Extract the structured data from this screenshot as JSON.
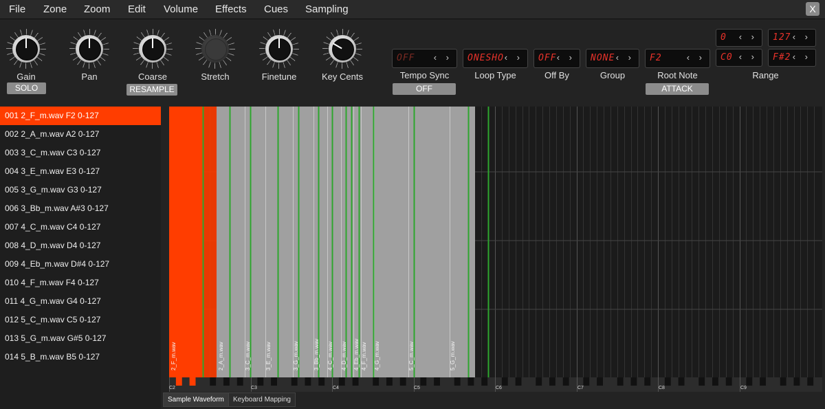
{
  "menu": [
    "File",
    "Zone",
    "Zoom",
    "Edit",
    "Volume",
    "Effects",
    "Cues",
    "Sampling"
  ],
  "close_label": "X",
  "knobs": [
    {
      "label": "Gain",
      "angle": 0
    },
    {
      "label": "Pan",
      "angle": 0
    },
    {
      "label": "Coarse",
      "angle": 0
    },
    {
      "label": "Stretch",
      "angle": 0
    },
    {
      "label": "Finetune",
      "angle": 0
    },
    {
      "label": "Key Cents",
      "angle": -60
    }
  ],
  "buttons": {
    "solo": "SOLO",
    "resample": "RESAMPLE",
    "tempo_sync": "OFF",
    "attack": "ATTACK"
  },
  "params": {
    "tempo_sync": {
      "value": "OFF",
      "label": "Tempo Sync"
    },
    "loop_type": {
      "value": "ONESHO",
      "label": "Loop Type"
    },
    "off_by": {
      "value": "OFF",
      "label": "Off By"
    },
    "group": {
      "value": "NONE",
      "label": "Group"
    },
    "root_note": {
      "value": "F2",
      "label": "Root Note"
    },
    "range": {
      "label": "Range",
      "vel_low": "0",
      "vel_high": "127",
      "key_low": "C0",
      "key_high": "F#2"
    }
  },
  "arrows": "‹ ›",
  "samples": [
    "001 2_F_m.wav F2 0-127",
    "002 2_A_m.wav A2 0-127",
    "003 3_C_m.wav C3 0-127",
    "004 3_E_m.wav E3 0-127",
    "005 3_G_m.wav G3 0-127",
    "006 3_Bb_m.wav A#3 0-127",
    "007 4_C_m.wav C4 0-127",
    "008 4_D_m.wav D4 0-127",
    "009 4_Eb_m.wav D#4 0-127",
    "010 4_F_m.wav F4 0-127",
    "011 4_G_m.wav G4 0-127",
    "012 5_C_m.wav C5 0-127",
    "013 5_G_m.wav G#5 0-127",
    "014 5_B_m.wav B5 0-127"
  ],
  "zone_labels": [
    "2_F_m.wav",
    "2_A_m.wav",
    "3_C_m.wav",
    "3_E_m.wav",
    "3_G_m.wav",
    "3_Bb_m.wav",
    "4_C_m.wav",
    "4_D_m.wav",
    "4_Eb_m.wav",
    "4_F_m.wav",
    "4_G_m.wav",
    "5_C_m.wav",
    "5_G_m.wav"
  ],
  "octaves": [
    "C2",
    "C3",
    "C4",
    "C5",
    "C6",
    "C7",
    "C8",
    "C9"
  ],
  "tabs": [
    "Sample Waveform",
    "Keyboard Mapping"
  ],
  "colors": {
    "accent": "#ff3d00",
    "zone_fill": "#a0a0a0",
    "root_line": "#2ea62e",
    "lcd_text": "#e8322a"
  }
}
